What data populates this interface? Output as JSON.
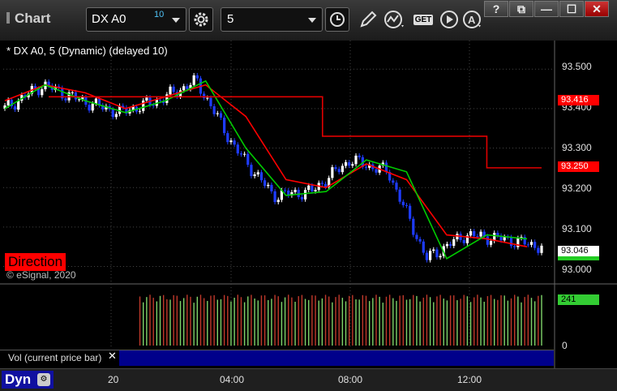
{
  "window": {
    "title": "Chart",
    "buttons": [
      "?",
      "⧉",
      "—",
      "☐",
      "✕"
    ]
  },
  "toolbar": {
    "symbol": "DX A0",
    "delay_badge": "10",
    "interval": "5",
    "get_label": "GET"
  },
  "chart": {
    "title": "* DX A0, 5 (Dynamic) (delayed 10)",
    "direction_label": "Direction",
    "copyright": "© eSignal, 2020",
    "price_axis": [
      "93.500",
      "93.400",
      "93.300",
      "93.200",
      "93.100",
      "93.000"
    ],
    "price_tags": {
      "upper_red": "93.416",
      "lower_red": "93.250",
      "last": "93.046"
    },
    "colors": {
      "up_candle": "#ffffff",
      "down_candle": "#1e3cff",
      "fast_ma": "#00cc00",
      "slow_ma": "#ff0000",
      "stop_line": "#e00000",
      "vol_up": "#7fd46a",
      "vol_down": "#c0392b",
      "vol_tag": "#33cc33"
    }
  },
  "volume": {
    "header": "Vol (current price bar)",
    "close": "✕",
    "current": "241",
    "zero": "0"
  },
  "bottom": {
    "mode": "Dyn",
    "time_labels": [
      "20",
      "04:00",
      "08:00",
      "12:00"
    ]
  },
  "chart_data": {
    "type": "line",
    "title": "* DX A0, 5 (Dynamic) (delayed 10)",
    "xlabel": "",
    "ylabel": "",
    "x": [
      "20",
      "04:00",
      "08:00",
      "12:00"
    ],
    "ylim": [
      92.96,
      93.56
    ],
    "series": [
      {
        "values": [
          93.4,
          93.46,
          93.42,
          93.39,
          93.42,
          93.47,
          93.3,
          93.18,
          93.19,
          93.27,
          93.24,
          93.02,
          93.08,
          93.07,
          93.05
        ]
      },
      {
        "values": [
          93.42,
          93.46,
          93.44,
          93.4,
          93.43,
          93.46,
          93.38,
          93.22,
          93.2,
          93.26,
          93.22,
          93.08,
          93.07,
          93.05
        ]
      },
      {
        "values": [
          93.43,
          93.43,
          93.43,
          93.43,
          93.43,
          93.33,
          93.33,
          93.33,
          93.25,
          93.25
        ]
      }
    ]
  }
}
